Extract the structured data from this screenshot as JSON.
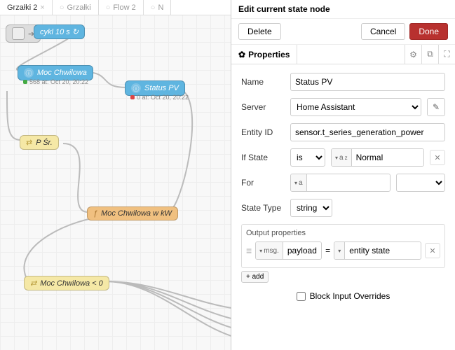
{
  "tabs": [
    {
      "label": "Grzałki 2",
      "active": true
    },
    {
      "label": "Grzałki",
      "active": false
    },
    {
      "label": "Flow 2",
      "active": false
    },
    {
      "label": "N",
      "active": false
    }
  ],
  "nodes": {
    "inject": {
      "label": "cykl 10 s ↻"
    },
    "moc_chwilowa": {
      "label": "Moc Chwilowa",
      "status": "568 at: Oct 20, 20:22"
    },
    "status_pv": {
      "label": "Status PV",
      "status": "0 at: Oct 20, 20:22"
    },
    "p_sr": {
      "label": "P Śr."
    },
    "moc_kw": {
      "label": "Moc Chwilowa w kW"
    },
    "moc_lt0": {
      "label": "Moc Chwilowa < 0"
    }
  },
  "panel": {
    "title": "Edit current state node",
    "buttons": {
      "delete": "Delete",
      "cancel": "Cancel",
      "done": "Done"
    },
    "properties_tab": "Properties",
    "form": {
      "name_label": "Name",
      "name_value": "Status PV",
      "server_label": "Server",
      "server_value": "Home Assistant",
      "entity_label": "Entity ID",
      "entity_value": "sensor.t_series_generation_power",
      "ifstate_label": "If State",
      "ifstate_op": "is",
      "ifstate_value": "Normal",
      "for_label": "For",
      "statetype_label": "State Type",
      "statetype_value": "string",
      "output_title": "Output properties",
      "output_msg_prefix": "msg.",
      "output_msg_field": "payload",
      "output_value": "entity state",
      "add_label": "+ add",
      "block_overrides": "Block Input Overrides"
    }
  }
}
